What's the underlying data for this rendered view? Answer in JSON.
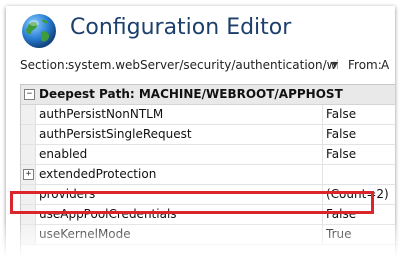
{
  "window": {
    "title": "Configuration Editor",
    "icon": "globe-icon"
  },
  "section": {
    "label": "Section:",
    "value": "system.webServer/security/authentication/win",
    "from_label": "From:",
    "from_value": "A"
  },
  "grid": {
    "group_header": {
      "expander": "−",
      "label": "Deepest Path: MACHINE/WEBROOT/APPHOST"
    },
    "rows": [
      {
        "name": "authPersistNonNTLM",
        "value": "False"
      },
      {
        "name": "authPersistSingleRequest",
        "value": "False"
      },
      {
        "name": "enabled",
        "value": "False"
      },
      {
        "name": "extendedProtection",
        "value": "",
        "expander": "+"
      },
      {
        "name": "providers",
        "value": "(Count=2)"
      },
      {
        "name": "useAppPoolCredentials",
        "value": "False"
      },
      {
        "name": "useKernelMode",
        "value": "True"
      }
    ]
  },
  "colors": {
    "title": "#1c3f6b",
    "highlight_border": "#d9252b",
    "header_bg": "#e9e9e9"
  }
}
